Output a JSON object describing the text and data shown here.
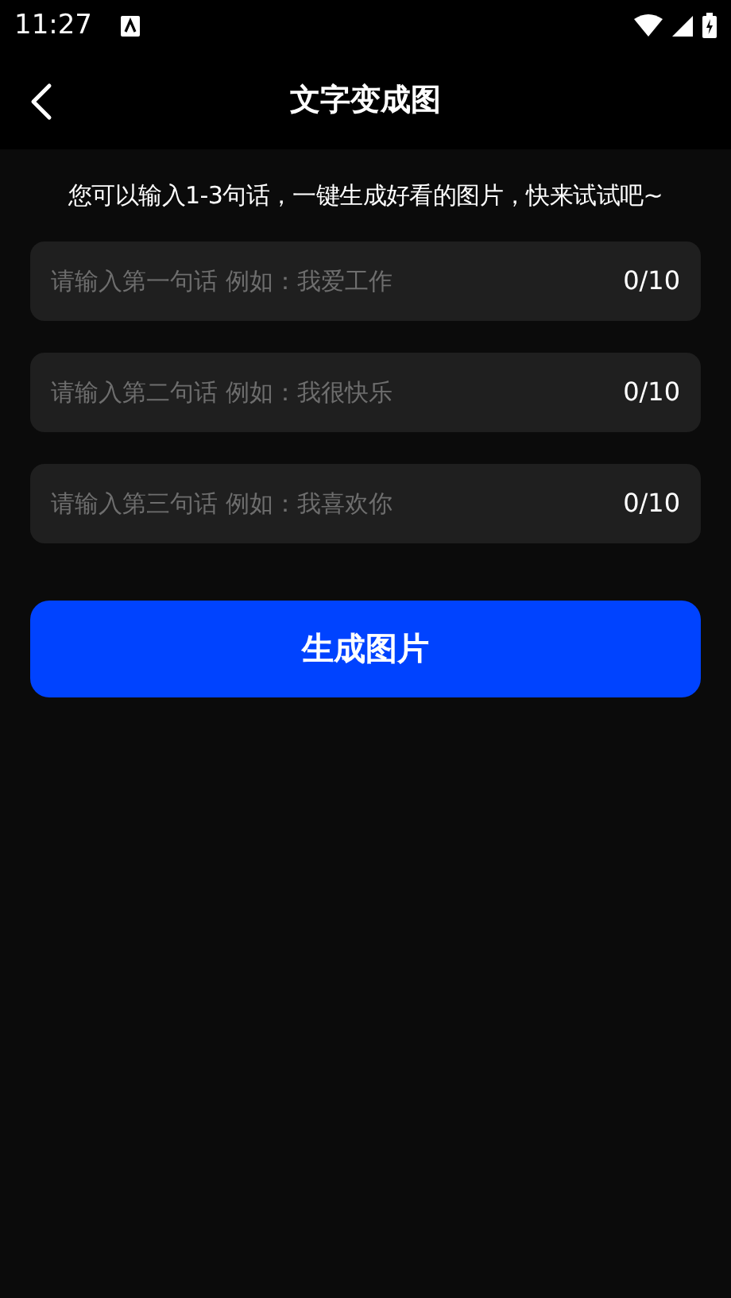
{
  "status_bar": {
    "time": "11:27"
  },
  "header": {
    "title": "文字变成图"
  },
  "intro": "您可以输入1-3句话，一键生成好看的图片，快来试试吧~",
  "fields": [
    {
      "placeholder": "请输入第一句话 例如：我爱工作",
      "counter": "0/10"
    },
    {
      "placeholder": "请输入第二句话 例如：我很快乐",
      "counter": "0/10"
    },
    {
      "placeholder": "请输入第三句话 例如：我喜欢你",
      "counter": "0/10"
    }
  ],
  "button": "生成图片"
}
